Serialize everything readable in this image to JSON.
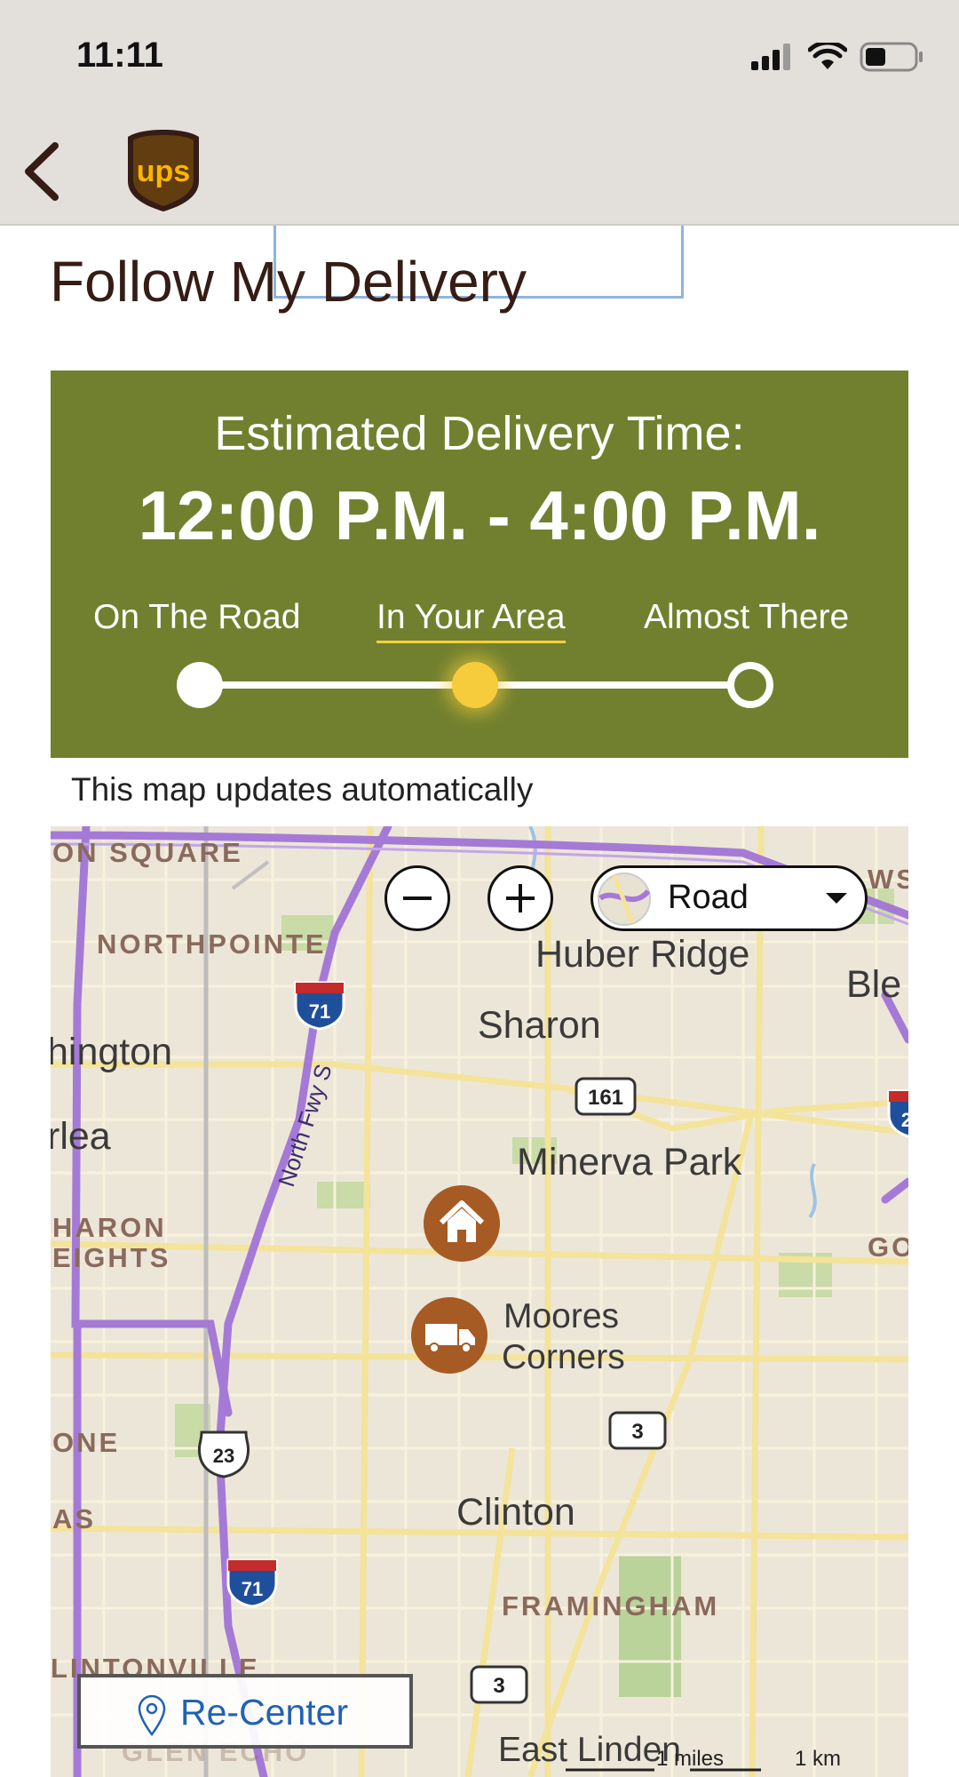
{
  "status_bar": {
    "time": "11:11"
  },
  "header": {
    "back_label": "Back",
    "logo_text": "ups"
  },
  "page": {
    "title": "Follow My Delivery"
  },
  "delivery": {
    "estimate_label": "Estimated Delivery Time:",
    "estimate_window": "12:00 P.M. - 4:00 P.M.",
    "steps": [
      {
        "label": "On The Road",
        "state": "complete"
      },
      {
        "label": "In Your Area",
        "state": "current"
      },
      {
        "label": "Almost There",
        "state": "pending"
      }
    ],
    "progress_step_index": 1
  },
  "map": {
    "note": "This map updates automatically",
    "map_type": "Road",
    "recenter_label": "Re-Center",
    "scale_miles": "1 miles",
    "scale_km": "1 km",
    "place_labels": [
      "Huber Ridge",
      "Sharon",
      "Minerva Park",
      "Moores",
      "Corners",
      "Clinton",
      "East Linden",
      "hington",
      "rlea",
      "Ble"
    ],
    "district_labels": [
      "ON SQUARE",
      "NORTHPOINTE",
      "HARON",
      "EIGHTS",
      "ONE",
      "AS",
      "FRAMINGHAM",
      "LINTONVILLE",
      "GLEN ECHO",
      "WS",
      "GO"
    ],
    "road_label": "North Fwy S",
    "route_shields": [
      "71",
      "161",
      "3",
      "23",
      "71",
      "3",
      "2"
    ]
  },
  "colors": {
    "brand_brown": "#351c15",
    "panel_green": "#71802f",
    "ups_gold": "#ffb500",
    "progress_yellow": "#f6cc3c",
    "marker_brown": "#a65a24",
    "link_blue": "#1f62b3"
  },
  "icons": [
    "back-chevron-icon",
    "ups-logo",
    "signal-icon",
    "wifi-icon",
    "battery-icon",
    "zoom-out-icon",
    "zoom-in-icon",
    "map-type-icon",
    "dropdown-arrow-icon",
    "home-marker-icon",
    "truck-marker-icon",
    "location-pin-icon"
  ]
}
